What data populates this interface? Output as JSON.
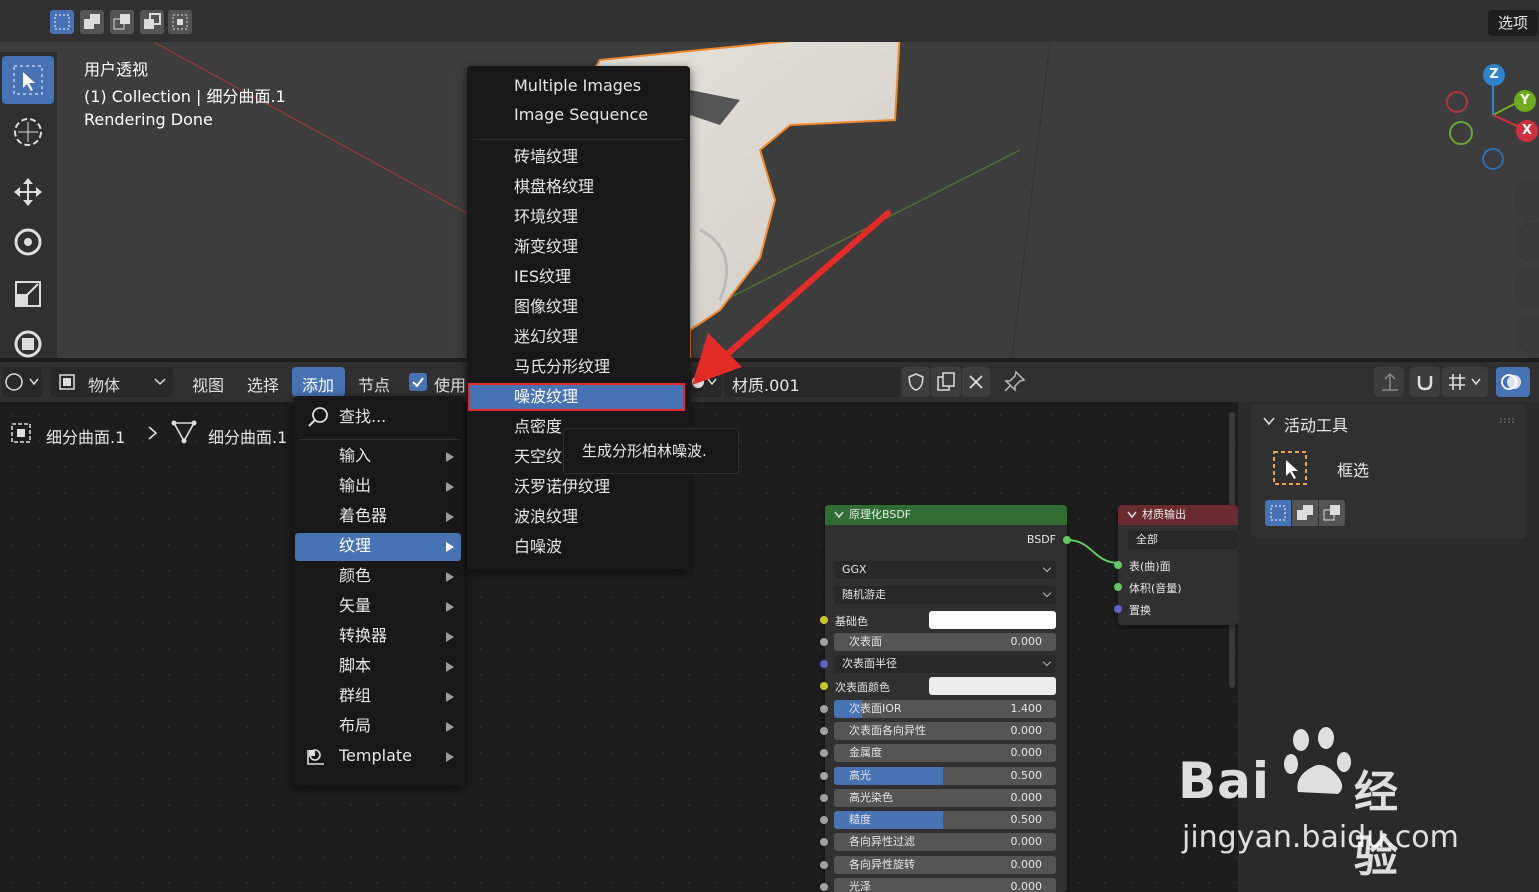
{
  "viewport": {
    "options_label": "选项",
    "info_lines": [
      "用户透视",
      "(1) Collection | 细分曲面.1",
      "Rendering Done"
    ]
  },
  "gizmo": {
    "z": "Z",
    "y": "Y",
    "x": "X"
  },
  "node_header": {
    "editor_type": "物体",
    "menu_view": "视图",
    "menu_select": "选择",
    "menu_add": "添加",
    "menu_node": "节点",
    "use_nodes_label": "使用",
    "material_name": "材质.001"
  },
  "breadcrumb": {
    "object": "细分曲面.1",
    "mesh": "细分曲面.1"
  },
  "add_menu": {
    "search": "查找...",
    "items": [
      "输入",
      "输出",
      "着色器",
      "纹理",
      "颜色",
      "矢量",
      "转换器",
      "脚本",
      "群组",
      "布局",
      "Template"
    ],
    "highlighted": "纹理"
  },
  "texture_menu": {
    "top_items": [
      "Multiple Images",
      "Image Sequence"
    ],
    "items": [
      "砖墙纹理",
      "棋盘格纹理",
      "环境纹理",
      "渐变纹理",
      "IES纹理",
      "图像纹理",
      "迷幻纹理",
      "马氏分形纹理",
      "噪波纹理",
      "点密度",
      "天空纹",
      "沃罗诺伊纹理",
      "波浪纹理",
      "白噪波"
    ],
    "highlighted": "噪波纹理"
  },
  "tooltip": "生成分形柏林噪波.",
  "bsdf_node": {
    "title": "原理化BSDF",
    "output": "BSDF",
    "distribution": "GGX",
    "subsurface_method": "随机游走",
    "base_color_label": "基础色",
    "subsurface_radius_label": "次表面半径",
    "subsurface_color_label": "次表面颜色",
    "fields": [
      {
        "label": "次表面",
        "value": "0.000",
        "fill": 0
      },
      {
        "label": "次表面IOR",
        "value": "1.400",
        "fill": 0.13
      },
      {
        "label": "次表面各向异性",
        "value": "0.000",
        "fill": 0
      },
      {
        "label": "金属度",
        "value": "0.000",
        "fill": 0
      },
      {
        "label": "高光",
        "value": "0.500",
        "fill": 0.5
      },
      {
        "label": "高光染色",
        "value": "0.000",
        "fill": 0
      },
      {
        "label": "糙度",
        "value": "0.500",
        "fill": 0.5
      },
      {
        "label": "各向异性过滤",
        "value": "0.000",
        "fill": 0
      },
      {
        "label": "各向异性旋转",
        "value": "0.000",
        "fill": 0
      },
      {
        "label": "光泽",
        "value": "0.000",
        "fill": 0
      }
    ]
  },
  "output_node": {
    "title": "材质输出",
    "target": "全部",
    "inputs": [
      "表(曲)面",
      "体积(音量)",
      "置换"
    ]
  },
  "npanel": {
    "section": "活动工具",
    "tool": "框选"
  },
  "watermark": {
    "brand": "Bai",
    "brand2": "经验",
    "url": "jingyan.baidu.com"
  },
  "colors": {
    "accent": "#4772b3",
    "bsdf_header": "#2f6d33",
    "output_header": "#6b2a2f",
    "socket_yellow": "#c7c729",
    "socket_gray": "#a1a1a1",
    "socket_purple": "#6363c7",
    "socket_green": "#63c763"
  }
}
